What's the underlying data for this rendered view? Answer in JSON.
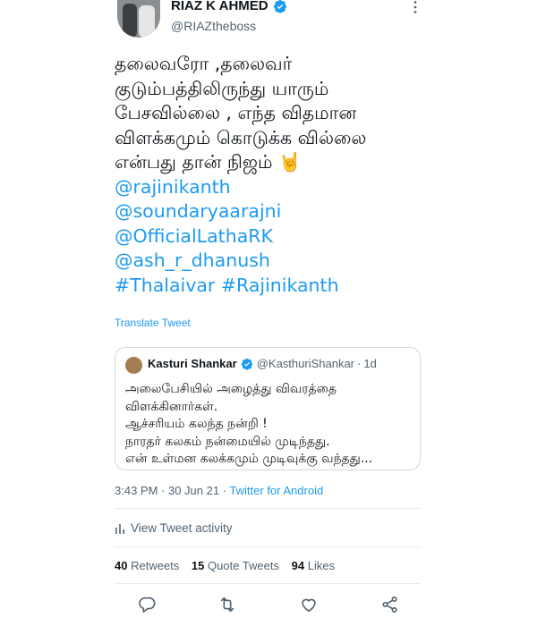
{
  "author": {
    "name": "RIAZ K AHMED",
    "handle": "@RIAZtheboss"
  },
  "tweet": {
    "lines": [
      "தலைவரோ ,தலைவர்",
      "குடும்பத்திலிருந்து யாரும்",
      "பேசவில்லை , எந்த விதமான",
      "விளக்கமும் கொடுக்க வில்லை",
      "என்பது தான் நிஜம் 🤘"
    ],
    "mentions": [
      "@rajinikanth",
      "@soundaryaarajni",
      "@OfficialLathaRK",
      "@ash_r_dhanush"
    ],
    "hashtags": [
      "#Thalaivar",
      "#Rajinikanth"
    ],
    "translate": "Translate Tweet"
  },
  "quote": {
    "name": "Kasturi Shankar",
    "handle": "@KasthuriShankar",
    "separator": "·",
    "time": "1d",
    "lines": [
      "அலைபேசியில் அழைத்து விவரத்தை",
      "விளக்கினார்கள்.",
      "ஆச்சரியம் கலந்த நன்றி  !",
      "நாரதர் கலகம்  நன்மையில் முடிந்தது.",
      " என் உள்மன கலக்கமும் முடிவுக்கு வந்தது..."
    ]
  },
  "meta": {
    "time": "3:43 PM",
    "date": "30 Jun 21",
    "separator": " · ",
    "source": "Twitter for Android"
  },
  "activity": {
    "label": "View Tweet activity"
  },
  "stats": {
    "retweets_count": "40",
    "retweets_label": "Retweets",
    "quotes_count": "15",
    "quotes_label": "Quote Tweets",
    "likes_count": "94",
    "likes_label": "Likes"
  },
  "colors": {
    "accent": "#1d9bf0",
    "text": "#0f1419",
    "muted": "#536471"
  },
  "icons": {
    "verified": "verified-badge-icon",
    "more": "more-options-icon",
    "reply": "reply-icon",
    "retweet": "retweet-icon",
    "like": "like-icon",
    "share": "share-icon",
    "activity": "bar-chart-icon"
  }
}
